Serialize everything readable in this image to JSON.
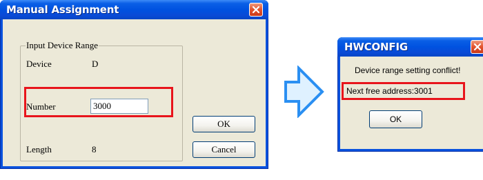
{
  "manual_assignment": {
    "title": "Manual Assignment",
    "group_label": "Input Device Range",
    "device_label": "Device",
    "device_value": "D",
    "number_label": "Number",
    "number_value": "3000",
    "length_label": "Length",
    "length_value": "8",
    "ok_label": "OK",
    "cancel_label": "Cancel"
  },
  "hwconfig": {
    "title": "HWCONFIG",
    "message": "Device range setting conflict!",
    "next_free": "Next free address:3001",
    "ok_label": "OK"
  },
  "colors": {
    "titlebar": "#0052e0",
    "highlight": "#e8141b",
    "arrow_fill": "#dff1ff",
    "arrow_stroke": "#2a8ff2"
  },
  "icons": [
    "close-icon",
    "right-arrow-icon"
  ]
}
